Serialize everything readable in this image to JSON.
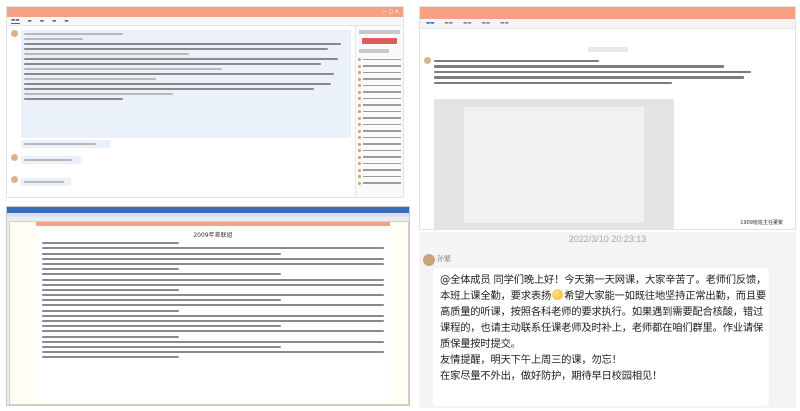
{
  "panel_b": {
    "signature": "1909班班主任董繁"
  },
  "panel_c": {
    "heading": "2009年差联组"
  },
  "panel_d": {
    "date": "2022/3/10 20:23:13",
    "sender": "孙繁",
    "lines": [
      "@全体成员 同学们晚上好！今天第一天网课，大家辛苦了。老师们反馈，",
      "本班上课全勤，要求表扬",
      "希望大家能一如既往地坚持正常出勤，而且要",
      "高质量的听课，按照各科老师的要求执行。如果遇到需要配合核酸，错过",
      "课程的，也请主动联系任课老师及时补上，老师都在咱们群里。作业请保",
      "质保量按时提交。",
      "友情提醒，明天下午上周三的课，勿忘！",
      "在家尽量不外出，做好防护，期待早日校园相见！"
    ]
  },
  "colors": {
    "titlebar": "#f4a283",
    "bubble": "#ffffff",
    "date": "#a8a8a8"
  }
}
